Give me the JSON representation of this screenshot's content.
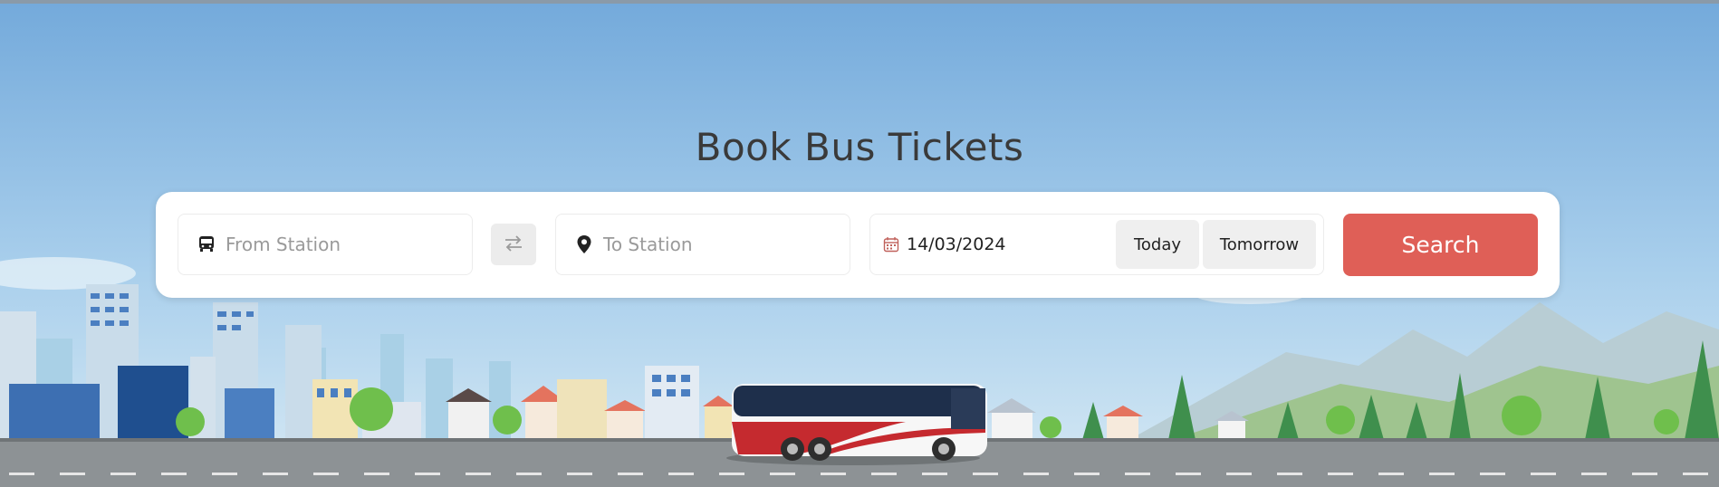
{
  "page": {
    "title": "Book Bus Tickets"
  },
  "search_form": {
    "from": {
      "placeholder": "From Station",
      "value": ""
    },
    "to": {
      "placeholder": "To Station",
      "value": ""
    },
    "date": {
      "value": "14/03/2024"
    },
    "today_label": "Today",
    "tomorrow_label": "Tomorrow",
    "search_label": "Search"
  },
  "icons": {
    "from": "bus-icon",
    "swap": "swap-arrows-icon",
    "to": "map-pin-icon",
    "date": "calendar-icon"
  },
  "colors": {
    "sky_top": "#74aadb",
    "sky_bottom": "#bcd9ee",
    "search_button": "#df5f57",
    "road": "#8d9295",
    "title_text": "#3a3a3a"
  }
}
